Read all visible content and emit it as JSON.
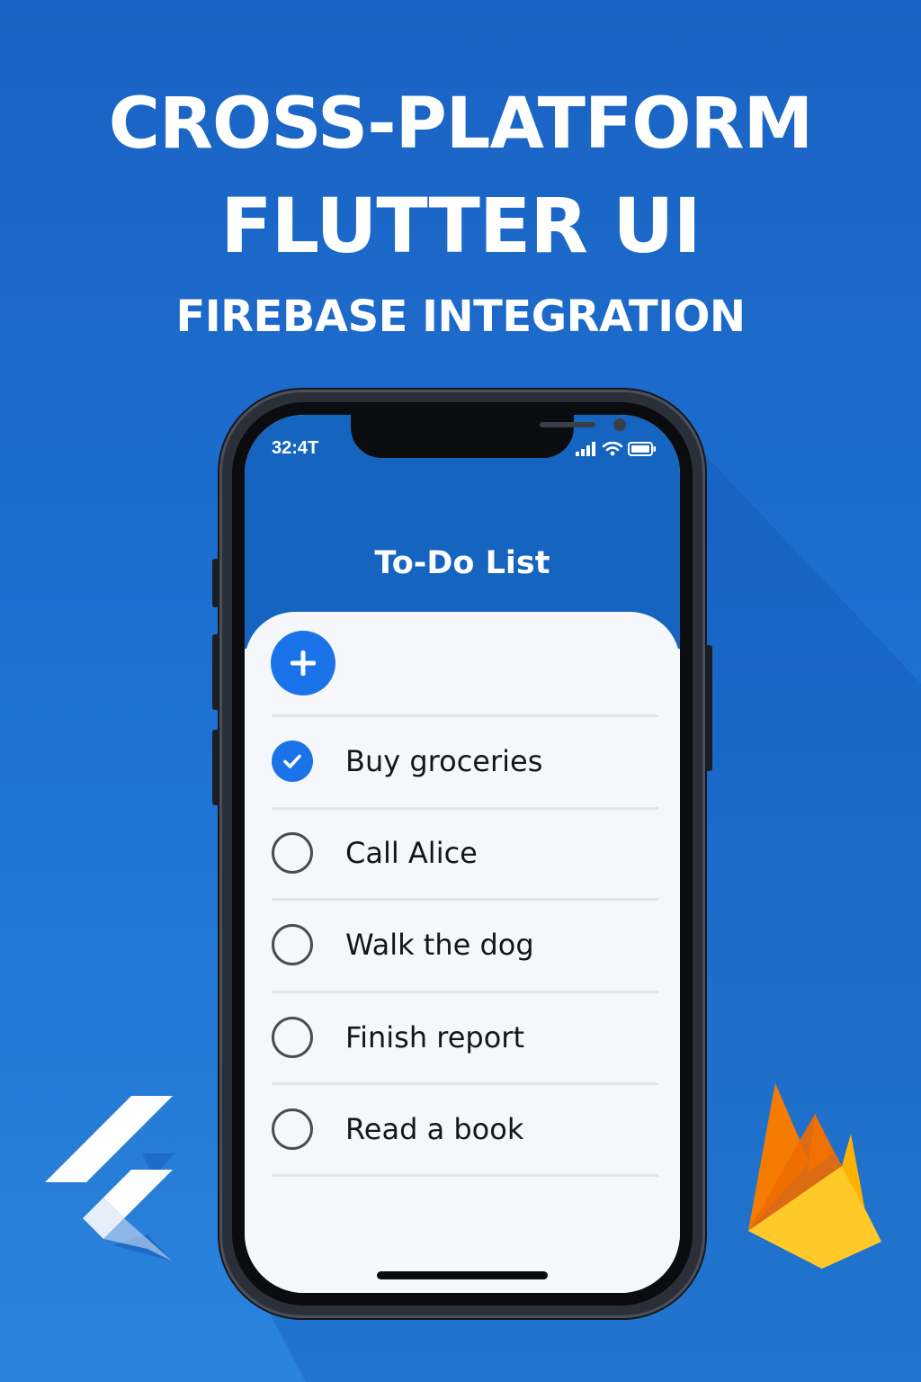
{
  "headline": {
    "line1": "CROSS-PLATFORM",
    "line2": "FLUTTER UI",
    "subtitle": "FIREBASE INTEGRATION"
  },
  "status_bar": {
    "time": "32:4T",
    "icons": [
      "signal-icon",
      "wifi-icon",
      "battery-icon"
    ]
  },
  "app": {
    "title": "To-Do List",
    "add_icon": "plus-icon",
    "tasks": [
      {
        "label": "Buy groceries",
        "completed": true
      },
      {
        "label": "Call Alice",
        "completed": false
      },
      {
        "label": "Walk the dog",
        "completed": false
      },
      {
        "label": "Finish report",
        "completed": false
      },
      {
        "label": "Read a book",
        "completed": false
      }
    ]
  },
  "logos": [
    "flutter-logo",
    "firebase-logo"
  ],
  "colors": {
    "background": "#1d6fd0",
    "app_bar": "#1565c0",
    "accent": "#1a73e8",
    "card": "#f6f7fa",
    "firebase_yellow": "#ffca28",
    "firebase_orange": "#f57c00"
  }
}
